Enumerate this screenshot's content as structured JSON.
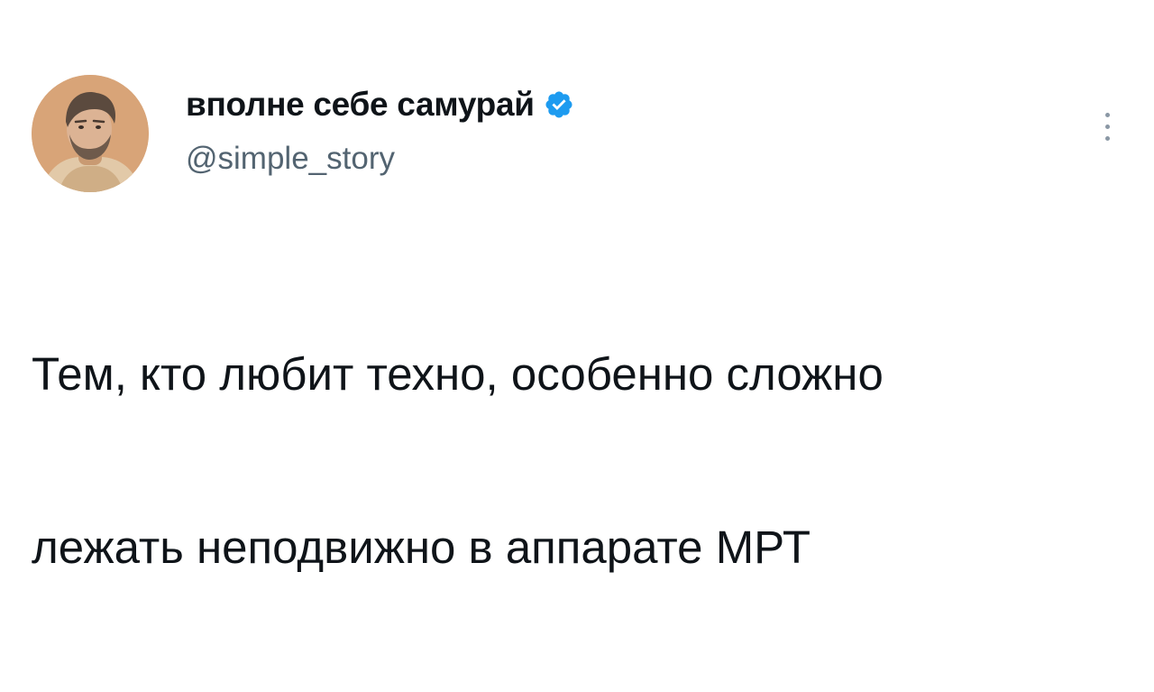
{
  "tweet": {
    "author": {
      "display_name": "вполне себе самурай",
      "handle": "@simple_story",
      "verified": true,
      "verified_icon": "verified-badge-icon",
      "avatar_icon": "profile-photo"
    },
    "text_lines": [
      "Тем, кто любит техно, особенно сложно",
      "лежать неподвижно в аппарате МРТ"
    ],
    "menu_icon": "more-options-icon"
  },
  "colors": {
    "text_primary": "#0f1419",
    "text_secondary": "#536471",
    "verified_blue": "#1d9bf0",
    "background": "#ffffff"
  }
}
